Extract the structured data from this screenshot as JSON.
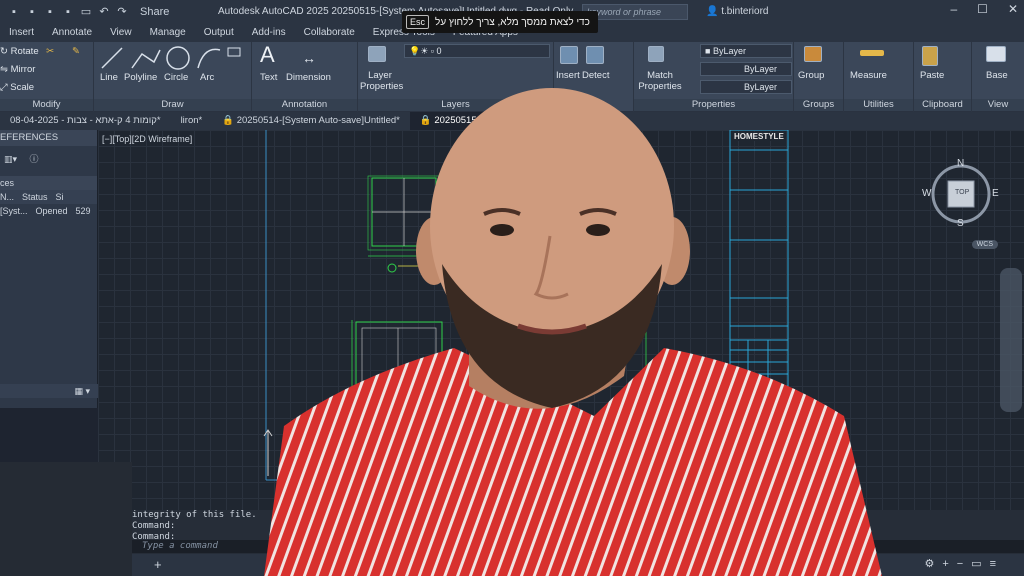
{
  "title_bar": {
    "share_label": "Share",
    "app_title": "Autodesk AutoCAD 2025  20250515-[System Autosave]Untitled.dwg - Read Only",
    "search_placeholder": "keyword or phrase",
    "user": "t.binteriord"
  },
  "esc_banner": {
    "key": "Esc",
    "text": "כדי לצאת ממסך מלא, צריך ללחוץ על"
  },
  "menu": [
    "Insert",
    "Annotate",
    "View",
    "Manage",
    "Output",
    "Add-ins",
    "Collaborate",
    "Express Tools",
    "Featured Apps"
  ],
  "ribbon": {
    "modify": {
      "label": "Modify",
      "items": [
        "Rotate",
        "Mirror",
        "Scale"
      ]
    },
    "draw": {
      "label": "Draw",
      "items": [
        "Line",
        "Polyline",
        "Circle",
        "Arc"
      ]
    },
    "annotation": {
      "label": "Annotation",
      "items": [
        "Text",
        "Dimension"
      ]
    },
    "layers": {
      "label": "Layers",
      "layer_props": "Layer Properties",
      "current_layer": "0"
    },
    "block": {
      "items": [
        "Insert",
        "Detect"
      ]
    },
    "properties": {
      "label": "Properties",
      "match": "Match Properties",
      "bylayer1": "ByLayer",
      "bylayer2": "ByLayer",
      "bylayer3": "ByLayer"
    },
    "groups": {
      "label": "Groups",
      "item": "Group"
    },
    "utilities": {
      "label": "Utilities",
      "item": "Measure"
    },
    "clipboard": {
      "label": "Clipboard",
      "item": "Paste"
    },
    "view": {
      "label": "View",
      "item": "Base"
    }
  },
  "doc_tabs": [
    "08-04-2025 - קומות 4 ק-אתא - צבות*",
    "liron*",
    "20250514-[System Auto-save]Untitled*",
    "20250515-[System Auto-save]Untitled"
  ],
  "xref_palette": {
    "title": "EFERENCES",
    "section": "ces",
    "columns": [
      "N...",
      "Status",
      "Si"
    ],
    "rows": [
      [
        "[Syst...",
        "Opened",
        "529"
      ]
    ]
  },
  "viewport": {
    "label": "[−][Top][2D Wireframe]",
    "navcube_top": "TOP",
    "compass": {
      "n": "N",
      "s": "S",
      "e": "E",
      "w": "W"
    },
    "wcs": "WCS",
    "title_block_brand": "HOMESTYLE"
  },
  "command_line": {
    "history": [
      "integrity of this file.",
      "Command:",
      "Command:"
    ],
    "placeholder": "Type a command"
  },
  "colors": {
    "title_bg": "#2b3442",
    "ribbon_bg": "#3b4759",
    "viewport_bg": "#1f2630",
    "drawing_green": "#2fd14a",
    "drawing_cyan": "#2aa7d8",
    "shirt_red": "#d8312e"
  }
}
